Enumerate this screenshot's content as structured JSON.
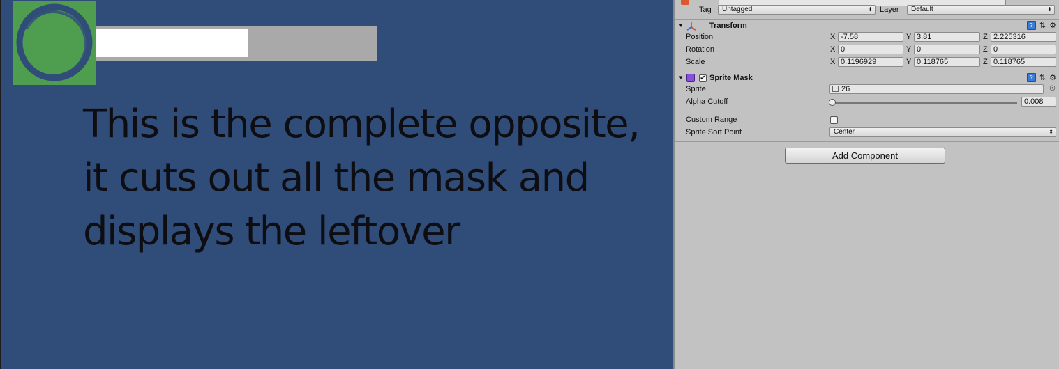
{
  "scene": {
    "text_lines": [
      "This is the complete opposite,",
      "it cuts out all the mask and",
      "displays the leftover"
    ],
    "bar_fill_fraction": 0.54,
    "colors": {
      "background": "#2f4d78",
      "square": "#4f9e4f",
      "ring": "#2f4d78",
      "bar_track": "#a9a9a9",
      "bar_fill": "#ffffff"
    }
  },
  "inspector": {
    "tag_label": "Tag",
    "tag_value": "Untagged",
    "layer_label": "Layer",
    "layer_value": "Default",
    "transform": {
      "title": "Transform",
      "rows": [
        {
          "label": "Position",
          "x": "-7.58",
          "y": "3.81",
          "z": "2.225316"
        },
        {
          "label": "Rotation",
          "x": "0",
          "y": "0",
          "z": "0"
        },
        {
          "label": "Scale",
          "x": "0.1196929",
          "y": "0.118765",
          "z": "0.118765"
        }
      ],
      "axis": {
        "x": "X",
        "y": "Y",
        "z": "Z"
      }
    },
    "sprite_mask": {
      "title": "Sprite Mask",
      "enabled": true,
      "sprite_label": "Sprite",
      "sprite_value": "26",
      "alpha_label": "Alpha Cutoff",
      "alpha_value": "0.008",
      "alpha_fraction": 0.008,
      "custom_range_label": "Custom Range",
      "sort_point_label": "Sprite Sort Point",
      "sort_point_value": "Center"
    },
    "add_component": "Add Component",
    "icons": {
      "help": "help-icon",
      "presets": "presets-icon",
      "settings": "gear-icon"
    }
  }
}
